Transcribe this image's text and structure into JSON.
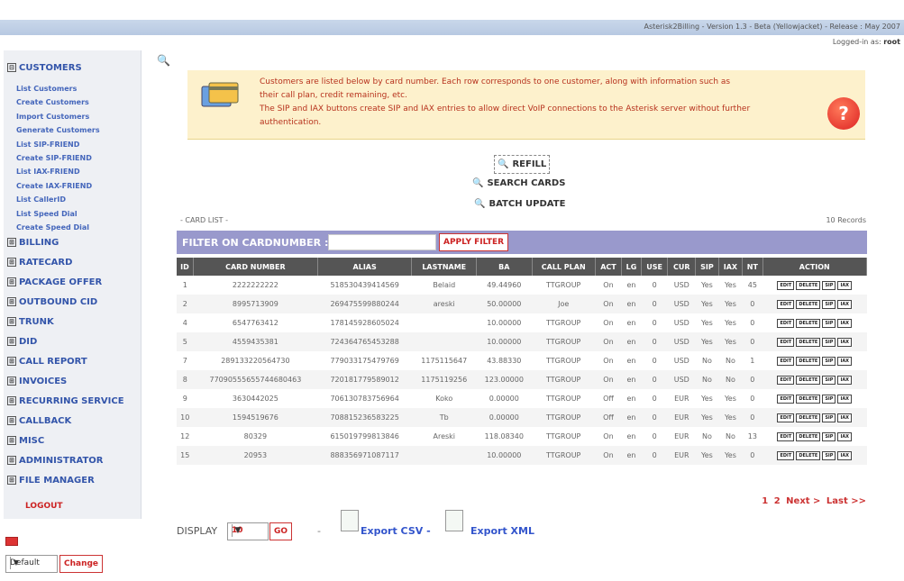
{
  "header": {
    "version": "Asterisk2Billing - Version 1.3 - Beta (Yellowjacket) - Release : May 2007",
    "logged_label": "Logged-in as:",
    "logged_user": "root"
  },
  "sidebar": {
    "customers": "CUSTOMERS",
    "customer_links": [
      "List Customers",
      "Create Customers",
      "Import Customers",
      "Generate Customers",
      "List SIP-FRIEND",
      "Create SIP-FRIEND",
      "List IAX-FRIEND",
      "Create IAX-FRIEND",
      "List CallerID",
      "List Speed Dial",
      "Create Speed Dial"
    ],
    "sections": [
      "BILLING",
      "RATECARD",
      "PACKAGE OFFER",
      "OUTBOUND CID",
      "TRUNK",
      "DID",
      "CALL REPORT",
      "INVOICES",
      "RECURRING SERVICE",
      "CALLBACK",
      "MISC",
      "ADMINISTRATOR",
      "FILE MANAGER"
    ],
    "logout": "LOGOUT",
    "collapse_glyph": "⊟",
    "expand_glyph": "⊞"
  },
  "language": {
    "value": "Default",
    "change": "Change"
  },
  "info": {
    "line1": "Customers are listed below by card number. Each row corresponds to one customer, along with information such as",
    "line2": "their call plan, credit remaining, etc.",
    "line3": "The SIP and IAX buttons create SIP and IAX entries to allow direct VoIP connections to the Asterisk server without further",
    "line4": "authentication."
  },
  "actions": {
    "refill": "REFILL",
    "search": "SEARCH CARDS",
    "batch": "BATCH UPDATE"
  },
  "list": {
    "title": "- CARD LIST -",
    "records": "10 Records"
  },
  "filter": {
    "label": "FILTER ON CARDNUMBER :",
    "value": "",
    "button": "APPLY FILTER"
  },
  "table": {
    "headers": [
      "ID",
      "CARD NUMBER",
      "ALIAS",
      "LASTNAME",
      "BA",
      "CALL PLAN",
      "ACT",
      "LG",
      "USE",
      "CUR",
      "SIP",
      "IAX",
      "NT",
      "ACTION"
    ],
    "rows": [
      [
        "1",
        "2222222222",
        "518530439414569",
        "Belaid",
        "49.44960",
        "TTGROUP",
        "On",
        "en",
        "0",
        "USD",
        "Yes",
        "Yes",
        "45"
      ],
      [
        "2",
        "8995713909",
        "269475599880244",
        "areski",
        "50.00000",
        "Joe",
        "On",
        "en",
        "0",
        "USD",
        "Yes",
        "Yes",
        "0"
      ],
      [
        "4",
        "6547763412",
        "178145928605024",
        "",
        "10.00000",
        "TTGROUP",
        "On",
        "en",
        "0",
        "USD",
        "Yes",
        "Yes",
        "0"
      ],
      [
        "5",
        "4559435381",
        "724364765453288",
        "",
        "10.00000",
        "TTGROUP",
        "On",
        "en",
        "0",
        "USD",
        "Yes",
        "Yes",
        "0"
      ],
      [
        "7",
        "289133220564730",
        "779033175479769",
        "1175115647",
        "43.88330",
        "TTGROUP",
        "On",
        "en",
        "0",
        "USD",
        "No",
        "No",
        "1"
      ],
      [
        "8",
        "77090555655744680463",
        "720181779589012",
        "1175119256",
        "123.00000",
        "TTGROUP",
        "On",
        "en",
        "0",
        "USD",
        "No",
        "No",
        "0"
      ],
      [
        "9",
        "3630442025",
        "706130783756964",
        "Koko",
        "0.00000",
        "TTGROUP",
        "Off",
        "en",
        "0",
        "EUR",
        "Yes",
        "Yes",
        "0"
      ],
      [
        "10",
        "1594519676",
        "708815236583225",
        "Tb",
        "0.00000",
        "TTGROUP",
        "Off",
        "en",
        "0",
        "EUR",
        "Yes",
        "Yes",
        "0"
      ],
      [
        "12",
        "80329",
        "615019799813846",
        "Areski",
        "118.08340",
        "TTGROUP",
        "On",
        "en",
        "0",
        "EUR",
        "No",
        "No",
        "13"
      ],
      [
        "15",
        "20953",
        "888356971087117",
        "",
        "10.00000",
        "TTGROUP",
        "On",
        "en",
        "0",
        "EUR",
        "Yes",
        "Yes",
        "0"
      ]
    ],
    "row_actions": [
      "EDIT",
      "DELETE",
      "SIP",
      "IAX"
    ]
  },
  "pager": {
    "p1": "1",
    "p2": "2",
    "next": "Next >",
    "last": "Last >>"
  },
  "footer": {
    "display": "DISPLAY",
    "display_value": "10",
    "go": "GO",
    "dash": "-",
    "export_csv": "Export CSV -",
    "export_xml": "Export XML"
  }
}
